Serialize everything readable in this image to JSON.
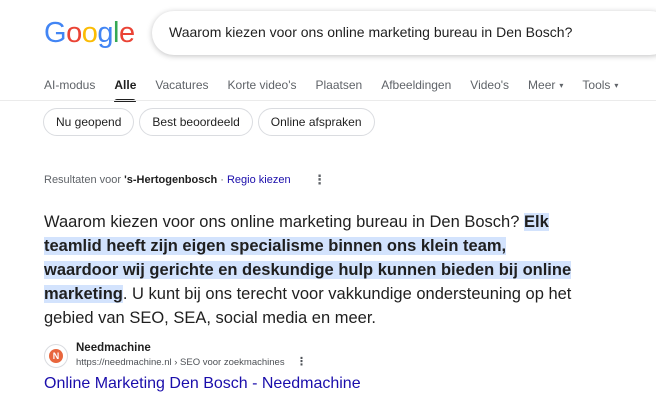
{
  "logo": {
    "letters": [
      "G",
      "o",
      "o",
      "g",
      "l",
      "e"
    ],
    "colors": [
      "#4285F4",
      "#EA4335",
      "#FBBC05",
      "#4285F4",
      "#34A853",
      "#EA4335"
    ]
  },
  "search": {
    "query": "Waarom kiezen voor ons online marketing bureau in Den Bosch?"
  },
  "tabs": [
    {
      "label": "AI-modus"
    },
    {
      "label": "Alle",
      "active": true
    },
    {
      "label": "Vacatures"
    },
    {
      "label": "Korte video's"
    },
    {
      "label": "Plaatsen"
    },
    {
      "label": "Afbeeldingen"
    },
    {
      "label": "Video's"
    },
    {
      "label": "Meer",
      "caret": "▾"
    },
    {
      "label": "Tools",
      "caret": "▾"
    }
  ],
  "chips": [
    "Nu geopend",
    "Best beoordeeld",
    "Online afspraken"
  ],
  "results_location": {
    "prefix": "Resultaten voor ",
    "location": "'s-Hertogenbosch",
    "separator": " · ",
    "link": "Regio kiezen"
  },
  "snippet": {
    "before": "Waarom kiezen voor ons online marketing bureau in Den Bosch? ",
    "highlight": "Elk teamlid heeft zijn eigen specialisme binnen ons klein team, waardoor wij gerichte en deskundige hulp kunnen bieden bij online marketing",
    "after": ". U kunt bij ons terecht voor vakkundige ondersteuning op het gebied van SEO, SEA, social media en meer."
  },
  "result": {
    "site_name": "Needmachine",
    "url": "https://needmachine.nl › SEO voor zoekmachines",
    "title": "Online Marketing Den Bosch - Needmachine",
    "favicon_letter": "N"
  },
  "icons": {
    "more_options": "more-vert-icon"
  },
  "colors": {
    "link": "#1a0dab",
    "highlight": "#d3e3fd",
    "favicon": "#e8663d"
  }
}
